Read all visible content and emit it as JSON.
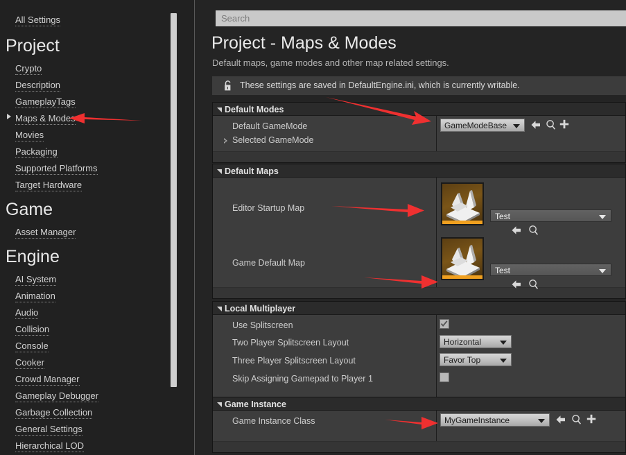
{
  "theme": {
    "accent_red": "#ef3030",
    "panel_bg": "#1c1c1c",
    "row_bg": "#3d3d3d",
    "header_bg": "#2b2b2b",
    "thumb_orange": "#f0a020"
  },
  "sidebar": {
    "top_link": {
      "label": "All Settings"
    },
    "groups": [
      {
        "title": "Project",
        "items": [
          {
            "label": "Crypto",
            "expandable": false,
            "selected": false
          },
          {
            "label": "Description",
            "expandable": false,
            "selected": false
          },
          {
            "label": "GameplayTags",
            "expandable": false,
            "selected": false
          },
          {
            "label": "Maps & Modes",
            "expandable": true,
            "selected": true
          },
          {
            "label": "Movies",
            "expandable": false,
            "selected": false
          },
          {
            "label": "Packaging",
            "expandable": false,
            "selected": false
          },
          {
            "label": "Supported Platforms",
            "expandable": false,
            "selected": false
          },
          {
            "label": "Target Hardware",
            "expandable": false,
            "selected": false
          }
        ]
      },
      {
        "title": "Game",
        "items": [
          {
            "label": "Asset Manager",
            "expandable": false,
            "selected": false
          }
        ]
      },
      {
        "title": "Engine",
        "items": [
          {
            "label": "AI System",
            "expandable": false,
            "selected": false
          },
          {
            "label": "Animation",
            "expandable": false,
            "selected": false
          },
          {
            "label": "Audio",
            "expandable": false,
            "selected": false
          },
          {
            "label": "Collision",
            "expandable": false,
            "selected": false
          },
          {
            "label": "Console",
            "expandable": false,
            "selected": false
          },
          {
            "label": "Cooker",
            "expandable": false,
            "selected": false
          },
          {
            "label": "Crowd Manager",
            "expandable": false,
            "selected": false
          },
          {
            "label": "Gameplay Debugger",
            "expandable": false,
            "selected": false
          },
          {
            "label": "Garbage Collection",
            "expandable": false,
            "selected": false
          },
          {
            "label": "General Settings",
            "expandable": false,
            "selected": false
          },
          {
            "label": "Hierarchical LOD",
            "expandable": false,
            "selected": false
          }
        ]
      }
    ]
  },
  "search": {
    "value": "",
    "placeholder": "Search",
    "icon": "search-icon"
  },
  "header": {
    "title": "Project - Maps & Modes",
    "subtitle": "Default maps, game modes and other map related settings.",
    "notice": {
      "icon": "unlocked-padlock-icon",
      "text": "These settings are saved in DefaultEngine.ini, which is currently writable."
    }
  },
  "sections": {
    "default_modes": {
      "title": "Default Modes",
      "expanded": true,
      "rows": {
        "default_gamemode": {
          "label": "Default GameMode",
          "value": "GameModeBase",
          "buttons": [
            "browse-back-icon",
            "magnifier-icon",
            "plus-icon"
          ]
        },
        "selected_gamemode": {
          "label": "Selected GameMode",
          "expandable": true
        }
      }
    },
    "default_maps": {
      "title": "Default Maps",
      "expanded": true,
      "rows": {
        "editor_startup_map": {
          "label": "Editor Startup Map",
          "value": "Test",
          "thumbnail": "map-thumbnail",
          "buttons": [
            "browse-back-icon",
            "magnifier-icon"
          ]
        },
        "game_default_map": {
          "label": "Game Default Map",
          "value": "Test",
          "thumbnail": "map-thumbnail",
          "buttons": [
            "browse-back-icon",
            "magnifier-icon"
          ]
        }
      }
    },
    "local_multiplayer": {
      "title": "Local Multiplayer",
      "expanded": true,
      "rows": {
        "use_splitscreen": {
          "label": "Use Splitscreen",
          "checked": true
        },
        "two_player_layout": {
          "label": "Two Player Splitscreen Layout",
          "value": "Horizontal"
        },
        "three_player_layout": {
          "label": "Three Player Splitscreen Layout",
          "value": "Favor Top"
        },
        "skip_gamepad": {
          "label": "Skip Assigning Gamepad to Player 1",
          "checked": false
        }
      }
    },
    "game_instance": {
      "title": "Game Instance",
      "expanded": true,
      "rows": {
        "game_instance_class": {
          "label": "Game Instance Class",
          "value": "MyGameInstance",
          "buttons": [
            "browse-back-icon",
            "magnifier-icon",
            "plus-icon"
          ]
        }
      }
    }
  },
  "annotations": [
    {
      "name": "arrow-to-maps-and-modes",
      "target": "Maps & Modes"
    },
    {
      "name": "arrow-to-default-gamemode",
      "target": "Default GameMode dropdown"
    },
    {
      "name": "arrow-to-editor-startup-map",
      "target": "Editor Startup Map"
    },
    {
      "name": "arrow-to-game-default-map",
      "target": "Game Default Map thumbnail"
    },
    {
      "name": "arrow-to-game-instance-class",
      "target": "Game Instance Class dropdown"
    }
  ]
}
